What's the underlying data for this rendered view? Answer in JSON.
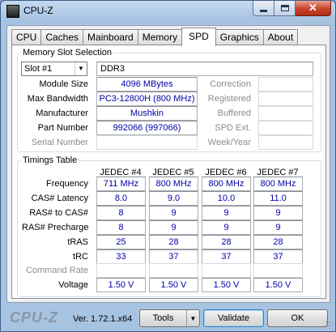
{
  "window": {
    "title": "CPU-Z",
    "icon_text": "CPU-Z"
  },
  "caption_buttons": {
    "minimize": "minimize",
    "maximize": "maximize",
    "close": "✕"
  },
  "tabs": [
    {
      "label": "CPU",
      "active": false
    },
    {
      "label": "Caches",
      "active": false
    },
    {
      "label": "Mainboard",
      "active": false
    },
    {
      "label": "Memory",
      "active": false
    },
    {
      "label": "SPD",
      "active": true
    },
    {
      "label": "Graphics",
      "active": false
    },
    {
      "label": "About",
      "active": false
    }
  ],
  "memory_slot": {
    "legend": "Memory Slot Selection",
    "slot_selected": "Slot #1",
    "memory_type": "DDR3",
    "left_rows": [
      {
        "label": "Module Size",
        "value": "4096 MBytes",
        "enabled": true
      },
      {
        "label": "Max Bandwidth",
        "value": "PC3-12800H (800 MHz)",
        "enabled": true
      },
      {
        "label": "Manufacturer",
        "value": "Mushkin",
        "enabled": true
      },
      {
        "label": "Part Number",
        "value": "992066 (997066)",
        "enabled": true
      },
      {
        "label": "Serial Number",
        "value": "",
        "enabled": false
      }
    ],
    "right_rows": [
      {
        "label": "Correction",
        "value": ""
      },
      {
        "label": "Registered",
        "value": ""
      },
      {
        "label": "Buffered",
        "value": ""
      },
      {
        "label": "SPD Ext.",
        "value": ""
      },
      {
        "label": "Week/Year",
        "value": ""
      }
    ]
  },
  "timings": {
    "legend": "Timings Table",
    "columns": [
      "JEDEC #4",
      "JEDEC #5",
      "JEDEC #6",
      "JEDEC #7"
    ],
    "rows": [
      {
        "label": "Frequency",
        "enabled": true,
        "values": [
          "711 MHz",
          "800 MHz",
          "800 MHz",
          "800 MHz"
        ]
      },
      {
        "label": "CAS# Latency",
        "enabled": true,
        "values": [
          "8.0",
          "9.0",
          "10.0",
          "11.0"
        ]
      },
      {
        "label": "RAS# to CAS#",
        "enabled": true,
        "values": [
          "8",
          "9",
          "9",
          "9"
        ]
      },
      {
        "label": "RAS# Precharge",
        "enabled": true,
        "values": [
          "8",
          "9",
          "9",
          "9"
        ]
      },
      {
        "label": "tRAS",
        "enabled": true,
        "values": [
          "25",
          "28",
          "28",
          "28"
        ]
      },
      {
        "label": "tRC",
        "enabled": true,
        "values": [
          "33",
          "37",
          "37",
          "37"
        ]
      },
      {
        "label": "Command Rate",
        "enabled": false,
        "values": [
          "",
          "",
          "",
          ""
        ]
      },
      {
        "label": "Voltage",
        "enabled": true,
        "values": [
          "1.50 V",
          "1.50 V",
          "1.50 V",
          "1.50 V"
        ]
      }
    ]
  },
  "footer": {
    "brand": "CPU-Z",
    "version": "Ver. 1.72.1.x64",
    "tools_label": "Tools",
    "validate_label": "Validate",
    "ok_label": "OK"
  },
  "colors": {
    "value_text": "#0000a8",
    "disabled_label": "#8c8c8c"
  }
}
